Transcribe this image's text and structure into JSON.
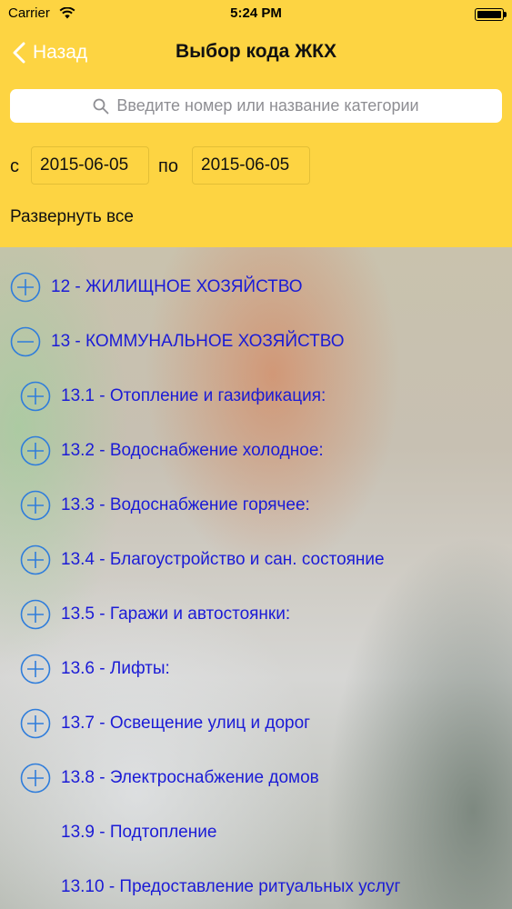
{
  "status": {
    "carrier": "Carrier",
    "time": "5:24 PM"
  },
  "nav": {
    "back_label": "Назад",
    "title": "Выбор кода ЖКХ"
  },
  "search": {
    "placeholder": "Введите номер или название категории"
  },
  "date_range": {
    "from_label": "с",
    "from_value": "2015-06-05",
    "to_label": "по",
    "to_value": "2015-06-05"
  },
  "expand_all_label": "Развернуть все",
  "list": {
    "items": [
      {
        "label": "12 - ЖИЛИЩНОЕ ХОЗЯЙСТВО",
        "icon": "plus-circle-icon"
      },
      {
        "label": "13 - КОММУНАЛЬНОЕ ХОЗЯЙСТВО",
        "icon": "minus-circle-icon"
      },
      {
        "label": "13.1 - Отопление и газификация:",
        "icon": "plus-circle-icon"
      },
      {
        "label": "13.2 - Водоснабжение холодное:",
        "icon": "plus-circle-icon"
      },
      {
        "label": "13.3 - Водоснабжение горячее:",
        "icon": "plus-circle-icon"
      },
      {
        "label": "13.4 - Благоустройство и  сан. состояние",
        "icon": "plus-circle-icon"
      },
      {
        "label": "13.5 - Гаражи и  автостоянки:",
        "icon": "plus-circle-icon"
      },
      {
        "label": "13.6 - Лифты:",
        "icon": "plus-circle-icon"
      },
      {
        "label": "13.7 - Освещение улиц и дорог",
        "icon": "plus-circle-icon"
      },
      {
        "label": "13.8 - Электроснабжение домов",
        "icon": "plus-circle-icon"
      },
      {
        "label": "13.9 - Подтопление",
        "icon": ""
      },
      {
        "label": "13.10 - Предоставление ритуальных услуг",
        "icon": ""
      }
    ]
  },
  "colors": {
    "header_bg": "#fdd442",
    "link_blue": "#1b1bd6",
    "icon_blue": "#2f7ddb"
  }
}
